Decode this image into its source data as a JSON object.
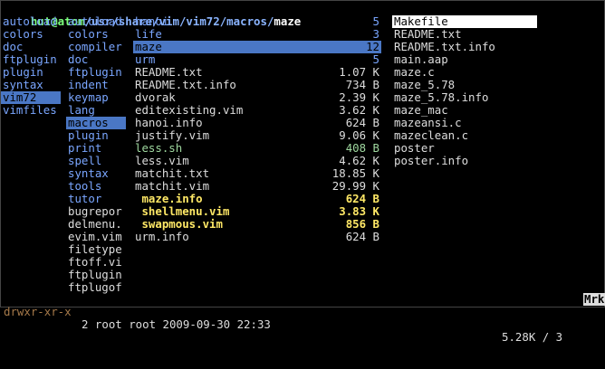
{
  "title": {
    "prefix": "hut@atom",
    "path": "/usr/share/vim/vim72/macros/",
    "current": "maze"
  },
  "col1": [
    {
      "name": "autoload",
      "type": "dir"
    },
    {
      "name": "colors",
      "type": "dir"
    },
    {
      "name": "doc",
      "type": "dir"
    },
    {
      "name": "ftplugin",
      "type": "dir"
    },
    {
      "name": "plugin",
      "type": "dir"
    },
    {
      "name": "syntax",
      "type": "dir"
    },
    {
      "name": "vim72",
      "type": "dir",
      "sel": true
    },
    {
      "name": "vimfiles",
      "type": "dir"
    }
  ],
  "col2": [
    {
      "name": "autoload",
      "type": "dir"
    },
    {
      "name": "colors",
      "type": "dir"
    },
    {
      "name": "compiler",
      "type": "dir"
    },
    {
      "name": "doc",
      "type": "dir"
    },
    {
      "name": "ftplugin",
      "type": "dir"
    },
    {
      "name": "indent",
      "type": "dir"
    },
    {
      "name": "keymap",
      "type": "dir"
    },
    {
      "name": "lang",
      "type": "dir"
    },
    {
      "name": "macros",
      "type": "dir",
      "sel": true
    },
    {
      "name": "plugin",
      "type": "dir"
    },
    {
      "name": "print",
      "type": "dir"
    },
    {
      "name": "spell",
      "type": "dir"
    },
    {
      "name": "syntax",
      "type": "dir"
    },
    {
      "name": "tools",
      "type": "dir"
    },
    {
      "name": "tutor",
      "type": "dir"
    },
    {
      "name": "bugrepor",
      "type": "file"
    },
    {
      "name": "delmenu.",
      "type": "file"
    },
    {
      "name": "evim.vim",
      "type": "file"
    },
    {
      "name": "filetype",
      "type": "file"
    },
    {
      "name": "ftoff.vi",
      "type": "file"
    },
    {
      "name": "ftplugin",
      "type": "file"
    },
    {
      "name": "ftplugof",
      "type": "file"
    }
  ],
  "col3": [
    {
      "name": "hanoi",
      "size": "5",
      "type": "dir"
    },
    {
      "name": "life",
      "size": "3",
      "type": "dir"
    },
    {
      "name": "maze",
      "size": "12",
      "type": "dir",
      "sel": true
    },
    {
      "name": "urm",
      "size": "5",
      "type": "dir"
    },
    {
      "name": "README.txt",
      "size": "1.07 K",
      "type": "file"
    },
    {
      "name": "README.txt.info",
      "size": "734 B",
      "type": "file"
    },
    {
      "name": "dvorak",
      "size": "2.39 K",
      "type": "file"
    },
    {
      "name": "editexisting.vim",
      "size": "3.62 K",
      "type": "file"
    },
    {
      "name": "hanoi.info",
      "size": "624 B",
      "type": "file"
    },
    {
      "name": "justify.vim",
      "size": "9.06 K",
      "type": "file"
    },
    {
      "name": "less.sh",
      "size": "408 B",
      "type": "exec"
    },
    {
      "name": "less.vim",
      "size": "4.62 K",
      "type": "file"
    },
    {
      "name": "matchit.txt",
      "size": "18.85 K",
      "type": "file"
    },
    {
      "name": "matchit.vim",
      "size": "29.99 K",
      "type": "file"
    },
    {
      "name": " maze.info",
      "size": "624 B",
      "type": "yellow"
    },
    {
      "name": " shellmenu.vim",
      "size": "3.83 K",
      "type": "yellow"
    },
    {
      "name": " swapmous.vim",
      "size": "856 B",
      "type": "yellow"
    },
    {
      "name": "urm.info",
      "size": "624 B",
      "type": "file"
    }
  ],
  "col4": [
    {
      "name": "Makefile",
      "type": "file",
      "sel": true
    },
    {
      "name": "README.txt",
      "type": "file"
    },
    {
      "name": "README.txt.info",
      "type": "file"
    },
    {
      "name": "main.aap",
      "type": "file"
    },
    {
      "name": "maze.c",
      "type": "file"
    },
    {
      "name": "maze_5.78",
      "type": "file"
    },
    {
      "name": "maze_5.78.info",
      "type": "file"
    },
    {
      "name": "maze_mac",
      "type": "file"
    },
    {
      "name": "mazeansi.c",
      "type": "file"
    },
    {
      "name": "mazeclean.c",
      "type": "file"
    },
    {
      "name": "poster",
      "type": "file"
    },
    {
      "name": "poster.info",
      "type": "file"
    }
  ],
  "status": {
    "perm": "drwxr-xr-x",
    "info": "2 root root 2009-09-30 22:33",
    "pos": "5.28K / 3",
    "mark": "Mrk"
  }
}
